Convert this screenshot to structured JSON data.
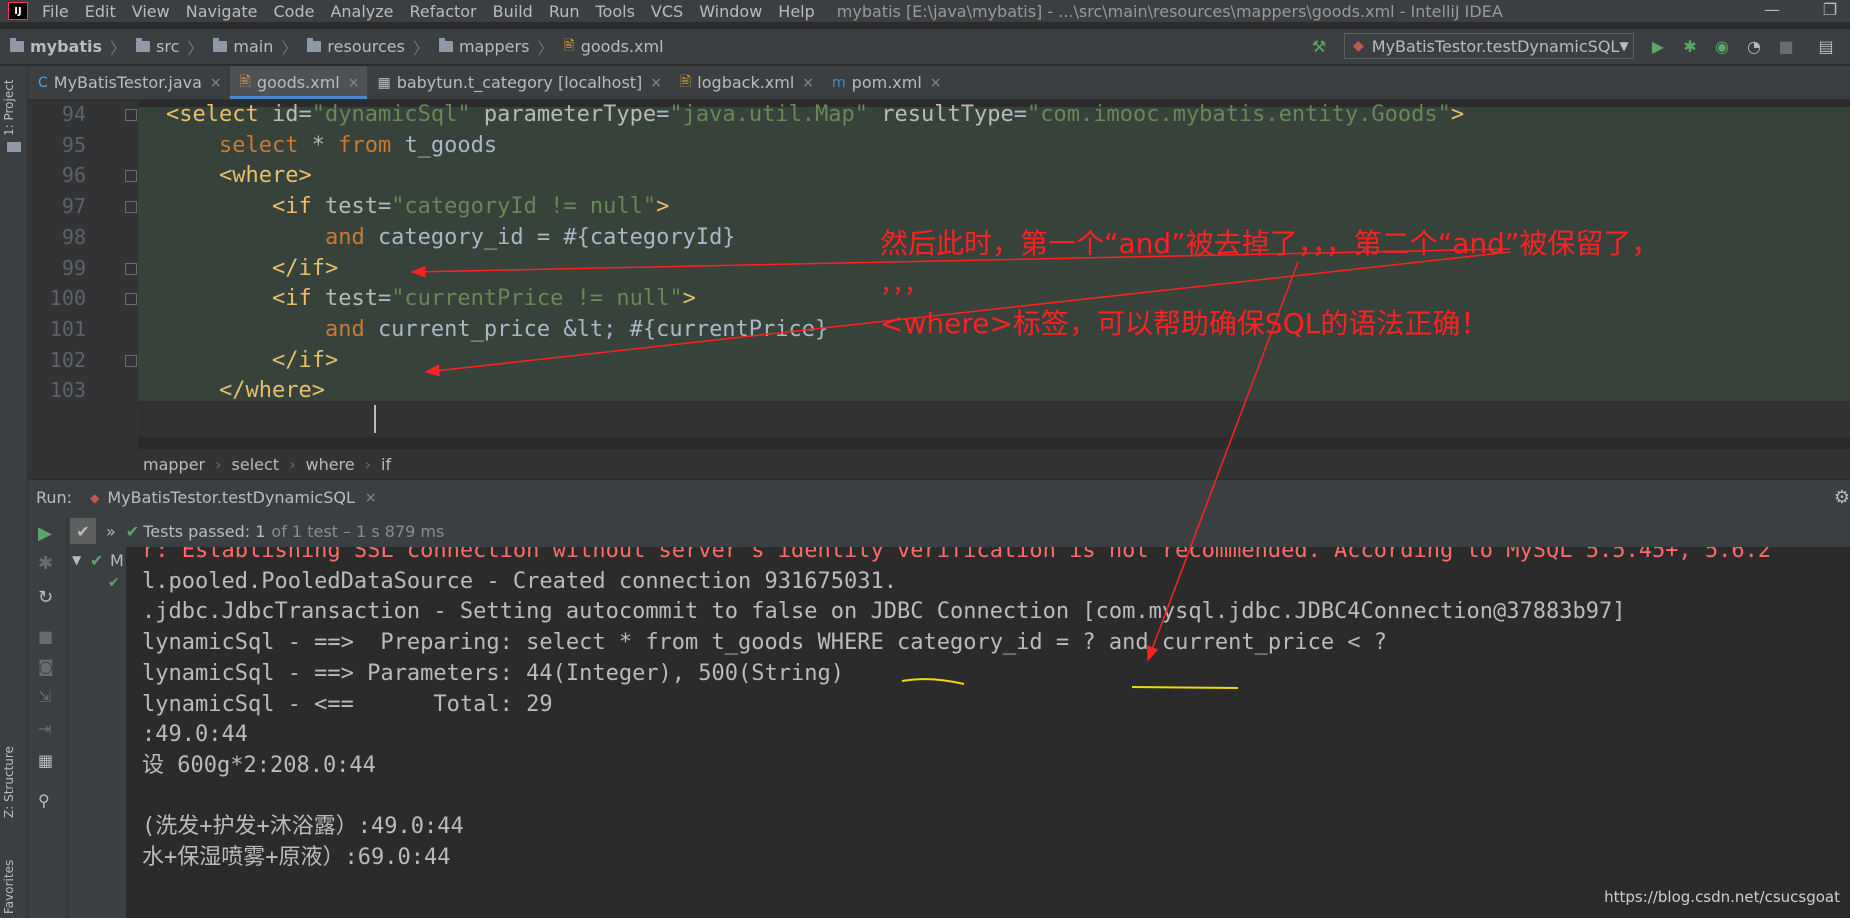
{
  "app": {
    "logo": "IJ",
    "menu": [
      "File",
      "Edit",
      "View",
      "Navigate",
      "Code",
      "Analyze",
      "Refactor",
      "Build",
      "Run",
      "Tools",
      "VCS",
      "Window",
      "Help"
    ],
    "window_title": "mybatis [E:\\java\\mybatis] - ...\\src\\main\\resources\\mappers\\goods.xml - IntelliJ IDEA",
    "minimize": "—",
    "restore": "❐"
  },
  "nav": {
    "breadcrumbs": [
      "mybatis",
      "src",
      "main",
      "resources",
      "mappers",
      "goods.xml"
    ],
    "run_config": "MyBatisTestor.testDynamicSQL",
    "run_config_caret": "▼"
  },
  "tabs": [
    {
      "label": "MyBatisTestor.java",
      "icon": "java-class-icon",
      "glyph": "C",
      "color": "#5a9fd6",
      "active": false
    },
    {
      "label": "goods.xml",
      "icon": "xml-file-icon",
      "glyph": "🖹",
      "color": "#e8a33d",
      "active": true
    },
    {
      "label": "babytun.t_category [localhost]",
      "icon": "table-icon",
      "glyph": "▦",
      "color": "#bbbbbb",
      "active": false
    },
    {
      "label": "logback.xml",
      "icon": "xml-file-icon",
      "glyph": "🖹",
      "color": "#e8a33d",
      "active": false
    },
    {
      "label": "pom.xml",
      "icon": "maven-icon",
      "glyph": "m",
      "color": "#4a88c7",
      "active": false
    }
  ],
  "tab_close": "×",
  "side_labels": {
    "project": "1: Project",
    "structure": "Z: Structure",
    "favorites": "Favorites"
  },
  "editor": {
    "line_numbers": [
      "94",
      "95",
      "96",
      "97",
      "98",
      "99",
      "100",
      "101",
      "102",
      "103"
    ],
    "lines": [
      {
        "num": "94",
        "tokens": [
          [
            "tag",
            "<select "
          ],
          [
            "attr",
            "id"
          ],
          [
            "txt",
            "="
          ],
          [
            "str",
            "\"dynamicSql\""
          ],
          [
            "txt",
            " "
          ],
          [
            "attr",
            "parameterType"
          ],
          [
            "txt",
            "="
          ],
          [
            "str",
            "\"java.util.Map\""
          ],
          [
            "txt",
            " "
          ],
          [
            "attr",
            "resultType"
          ],
          [
            "txt",
            "="
          ],
          [
            "str",
            "\"com.imooc.mybatis.entity.Goods\""
          ],
          [
            "tag",
            ">"
          ]
        ]
      },
      {
        "num": "95",
        "tokens": [
          [
            "txt",
            "    "
          ],
          [
            "kw",
            "select "
          ],
          [
            "txt",
            "* "
          ],
          [
            "kw",
            "from "
          ],
          [
            "txt",
            "t_goods"
          ]
        ]
      },
      {
        "num": "96",
        "tokens": [
          [
            "txt",
            "    "
          ],
          [
            "tag",
            "<where>"
          ]
        ]
      },
      {
        "num": "97",
        "tokens": [
          [
            "txt",
            "        "
          ],
          [
            "tag",
            "<if "
          ],
          [
            "attr",
            "test"
          ],
          [
            "txt",
            "="
          ],
          [
            "str",
            "\"categoryId != null\""
          ],
          [
            "tag",
            ">"
          ]
        ]
      },
      {
        "num": "98",
        "tokens": [
          [
            "txt",
            "            "
          ],
          [
            "kw",
            "and "
          ],
          [
            "txt",
            "category_id = #{categoryId}"
          ]
        ]
      },
      {
        "num": "99",
        "tokens": [
          [
            "txt",
            "        "
          ],
          [
            "tag",
            "</if>"
          ]
        ]
      },
      {
        "num": "100",
        "tokens": [
          [
            "txt",
            "        "
          ],
          [
            "tag",
            "<if "
          ],
          [
            "attr",
            "test"
          ],
          [
            "txt",
            "="
          ],
          [
            "str",
            "\"currentPrice != null\""
          ],
          [
            "tag",
            ">"
          ]
        ]
      },
      {
        "num": "101",
        "tokens": [
          [
            "txt",
            "            "
          ],
          [
            "kw",
            "and "
          ],
          [
            "txt",
            "current_price &lt; #{currentPrice}"
          ]
        ]
      },
      {
        "num": "102",
        "tokens": [
          [
            "txt",
            "        "
          ],
          [
            "tag",
            "</if>"
          ]
        ]
      },
      {
        "num": "103",
        "tokens": [
          [
            "txt",
            "    "
          ],
          [
            "tag",
            "</where>"
          ]
        ]
      }
    ]
  },
  "crumbbar": [
    "mapper",
    "select",
    "where",
    "if"
  ],
  "run": {
    "label": "Run:",
    "tab": "MyBatisTestor.testDynamicSQL",
    "status_prefix": "Tests passed: 1",
    "status_suffix": "of 1 test – 1 s 879 ms",
    "tree_item": "M"
  },
  "console": [
    {
      "text": "r: Establishing SSL connection without server's identity verification is not recommended. According to MySQL 5.5.45+, 5.6.2",
      "err": true
    },
    {
      "text": "l.pooled.PooledDataSource - Created connection 931675031.",
      "err": false
    },
    {
      "text": ".jdbc.JdbcTransaction - Setting autocommit to false on JDBC Connection [com.mysql.jdbc.JDBC4Connection@37883b97]",
      "err": false
    },
    {
      "text": "lynamicSql - ==>  Preparing: select * from t_goods WHERE category_id = ? and current_price < ?",
      "err": false
    },
    {
      "text": "lynamicSql - ==> Parameters: 44(Integer), 500(String)",
      "err": false
    },
    {
      "text": "lynamicSql - <==      Total: 29",
      "err": false
    },
    {
      "text": ":49.0:44",
      "err": false
    },
    {
      "text": "设 600g*2:208.0:44",
      "err": false
    },
    {
      "text": "",
      "err": false
    },
    {
      "text": "(洗发+护发+沐浴露）:49.0:44",
      "err": false
    },
    {
      "text": "水+保湿喷雾+原液）:69.0:44",
      "err": false
    }
  ],
  "annotations": {
    "line1": "然后此时，第一个“and”被去掉了，，，第二个“and”被保留了，",
    "line2": "，，，",
    "line3": "<where>标签，可以帮助确保SQL的语法正确！",
    "color": "#ff2222",
    "underline_color": "#f5d60a"
  },
  "watermark": "https://blog.csdn.net/csucsgoat"
}
